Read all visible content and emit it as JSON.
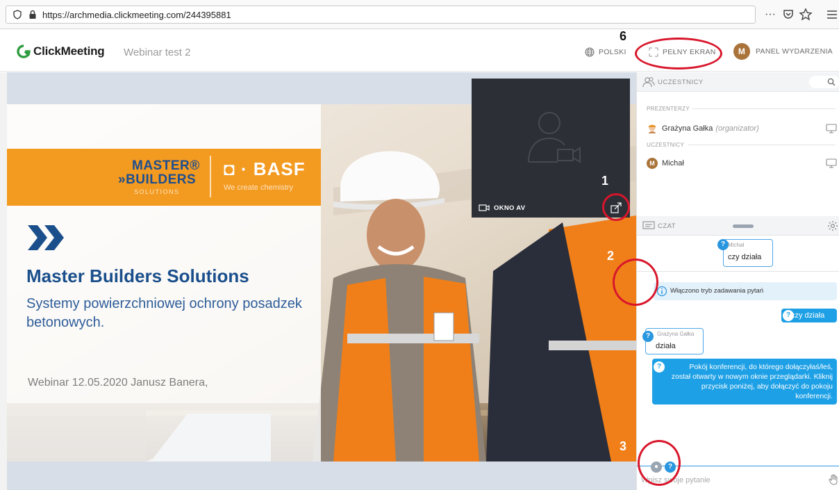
{
  "browser": {
    "url": "https://archmedia.clickmeeting.com/244395881",
    "more_glyph": "···"
  },
  "header": {
    "brand": "ClickMeeting",
    "event_title": "Webinar test 2",
    "language": "POLSKI",
    "fullscreen": "PEŁNY EKRAN",
    "avatar_initial": "M",
    "event_panel": "PANEL WYDARZENIA"
  },
  "slide": {
    "brand_line1": "MASTER®",
    "brand_line2": "»BUILDERS",
    "brand_line3": "SOLUTIONS",
    "basf": "◘ · BASF",
    "basf_tagline": "We create chemistry",
    "title": "Master Builders Solutions",
    "subtitle": "Systemy powierzchniowej ochrony posadzek betonowych.",
    "footer": "Webinar 12.05.2020 Janusz Banera,"
  },
  "av_window": {
    "label": "OKNO AV"
  },
  "participants": {
    "title": "UCZESTNICY",
    "presenters_label": "PREZENTERZY",
    "presenters": [
      {
        "name": "Grażyna Gałka",
        "role": "(organizator)"
      }
    ],
    "attendees_label": "UCZESTNICY",
    "attendees": [
      {
        "name": "Michał",
        "avatar": "M"
      }
    ]
  },
  "chat": {
    "title": "CZAT",
    "messages": [
      {
        "author": "Michał",
        "text": "czy działa"
      },
      {
        "info": "Włączono tryb zadawania pytań"
      },
      {
        "text": "czy działa"
      },
      {
        "author": "Grażyna Gałka",
        "text": "działa"
      },
      {
        "text": "Pokój konferencji, do którego dołączyłaś/łeś, został otwarty w nowym oknie przeglądarki. Kliknij przycisk poniżej, aby dołączyć do pokoju konferencji."
      }
    ],
    "badge": "?",
    "input_placeholder": "Wpisz swoje pytanie"
  },
  "annotations": [
    "1",
    "2",
    "3",
    "6"
  ],
  "colors": {
    "accent_blue": "#2996e0",
    "annotation_red": "#d8162b",
    "slide_orange": "#f39a20",
    "slide_blue": "#1a4f8c"
  },
  "icons": [
    "shield-icon",
    "lock-icon",
    "pocket-icon",
    "star-icon",
    "menu-icon",
    "globe-icon",
    "fullscreen-icon",
    "users-icon",
    "search-icon",
    "monitor-icon",
    "chat-icon",
    "gear-icon",
    "info-icon",
    "camera-icon",
    "expand-icon",
    "hand-icon"
  ]
}
